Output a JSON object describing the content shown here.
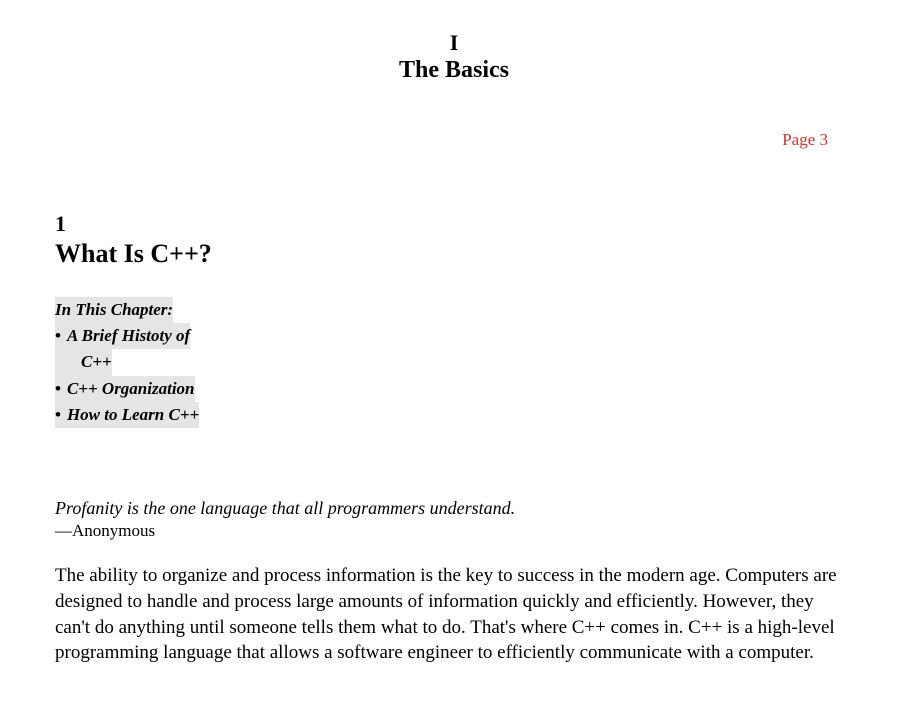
{
  "part": {
    "number": "I",
    "title": "The Basics"
  },
  "page_label": "Page 3",
  "chapter": {
    "number": "1",
    "title": "What Is C++?"
  },
  "in_this_chapter": {
    "heading": "In This Chapter:",
    "items": [
      "A Brief Histoty  of",
      "C++",
      "C++ Organization",
      "How to Learn C++"
    ]
  },
  "epigraph": {
    "quote": "Profanity is the one language that all programmers understand.",
    "attribution": "—Anonymous"
  },
  "paragraph": "The ability to organize and process information is the key to success in the modern age. Computers are designed to handle and process large amounts of information quickly and efficiently. However, they can't do anything until someone tells them what to do. That's where C++ comes in. C++ is a high-level programming language that allows a software engineer to efficiently communicate with a computer."
}
